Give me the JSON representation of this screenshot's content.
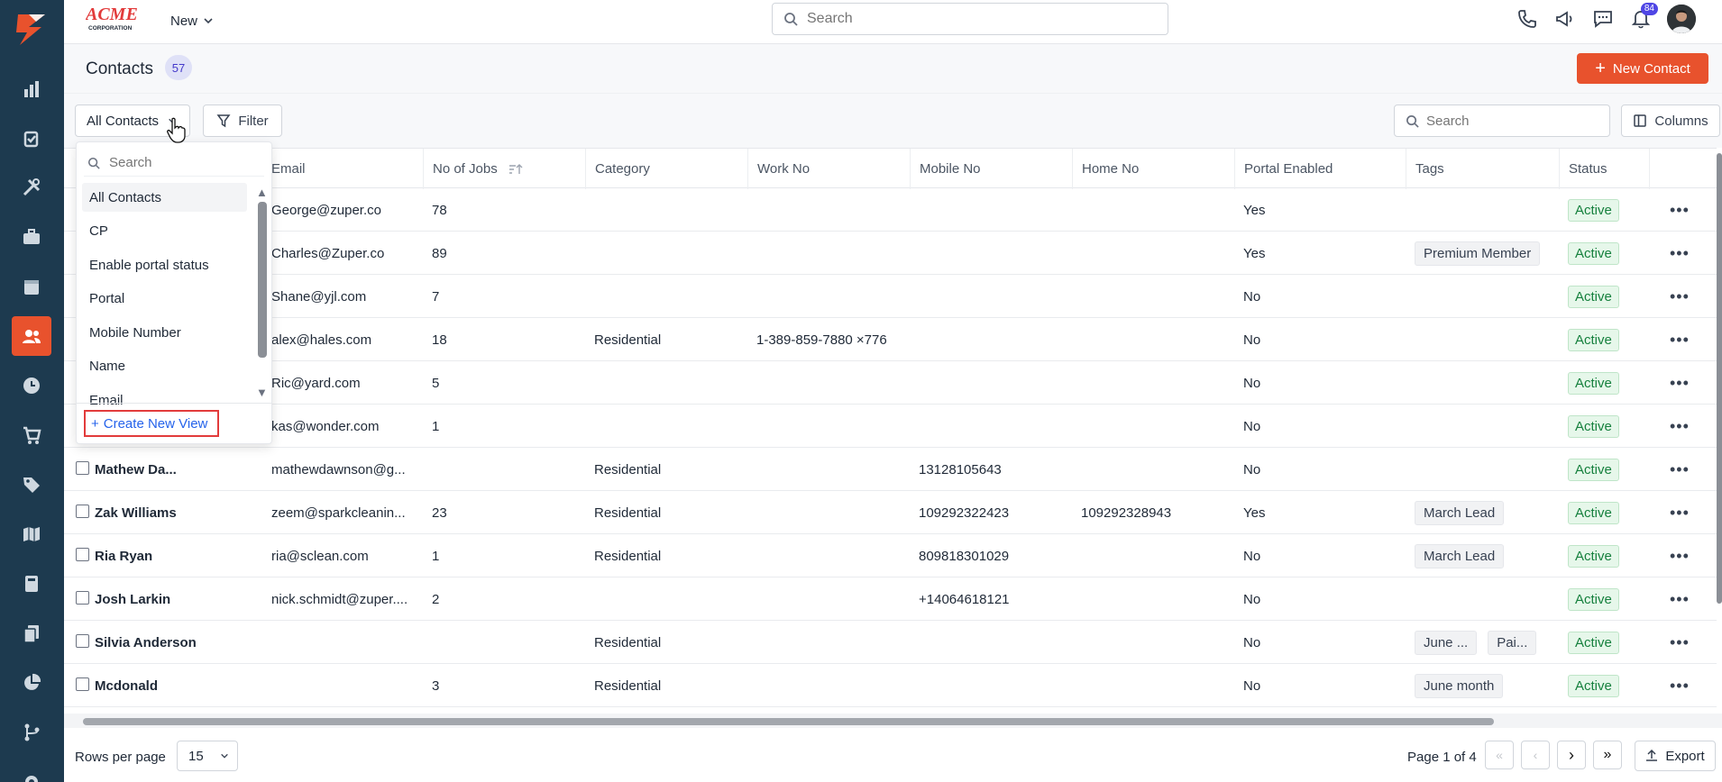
{
  "topbar": {
    "new_label": "New",
    "search_placeholder": "Search",
    "notification_count": "84"
  },
  "brand": {
    "name": "ACME",
    "sub": "CORPORATION"
  },
  "page": {
    "title": "Contacts",
    "count": "57",
    "new_button": "New Contact"
  },
  "toolbar": {
    "view_label": "All Contacts",
    "filter_label": "Filter",
    "search_placeholder": "Search",
    "columns_label": "Columns"
  },
  "columns": [
    "Email",
    "No of Jobs",
    "Category",
    "Work No",
    "Mobile No",
    "Home No",
    "Portal Enabled",
    "Tags",
    "Status"
  ],
  "rows": [
    {
      "name": "",
      "email": "George@zuper.co",
      "jobs": "78",
      "category": "",
      "work": "",
      "mobile": "",
      "home": "",
      "portal": "Yes",
      "tags": [],
      "status": "Active"
    },
    {
      "name": "",
      "email": "Charles@Zuper.co",
      "jobs": "89",
      "category": "",
      "work": "",
      "mobile": "",
      "home": "",
      "portal": "Yes",
      "tags": [
        "Premium Member"
      ],
      "status": "Active"
    },
    {
      "name": "",
      "email": "Shane@yjl.com",
      "jobs": "7",
      "category": "",
      "work": "",
      "mobile": "",
      "home": "",
      "portal": "No",
      "tags": [],
      "status": "Active"
    },
    {
      "name": "",
      "email": "alex@hales.com",
      "jobs": "18",
      "category": "Residential",
      "work": "1-389-859-7880 ×776",
      "mobile": "",
      "home": "",
      "portal": "No",
      "tags": [],
      "status": "Active"
    },
    {
      "name": "",
      "email": "Ric@yard.com",
      "jobs": "5",
      "category": "",
      "work": "",
      "mobile": "",
      "home": "",
      "portal": "No",
      "tags": [],
      "status": "Active"
    },
    {
      "name": "",
      "email": "kas@wonder.com",
      "jobs": "1",
      "category": "",
      "work": "",
      "mobile": "",
      "home": "",
      "portal": "No",
      "tags": [],
      "status": "Active"
    },
    {
      "name": "Mathew Da...",
      "email": "mathewdawnson@g...",
      "jobs": "",
      "category": "Residential",
      "work": "",
      "mobile": "13128105643",
      "home": "",
      "portal": "No",
      "tags": [],
      "status": "Active"
    },
    {
      "name": "Zak Williams",
      "email": "zeem@sparkcleanin...",
      "jobs": "23",
      "category": "Residential",
      "work": "",
      "mobile": "109292322423",
      "home": "109292328943",
      "portal": "Yes",
      "tags": [
        "March Lead"
      ],
      "status": "Active"
    },
    {
      "name": "Ria Ryan",
      "email": "ria@sclean.com",
      "jobs": "1",
      "category": "Residential",
      "work": "",
      "mobile": "809818301029",
      "home": "",
      "portal": "No",
      "tags": [
        "March Lead"
      ],
      "status": "Active"
    },
    {
      "name": "Josh Larkin",
      "email": "nick.schmidt@zuper....",
      "jobs": "2",
      "category": "",
      "work": "",
      "mobile": "+14064618121",
      "home": "",
      "portal": "No",
      "tags": [],
      "status": "Active"
    },
    {
      "name": "Silvia Anderson",
      "email": "",
      "jobs": "",
      "category": "Residential",
      "work": "",
      "mobile": "",
      "home": "",
      "portal": "No",
      "tags": [
        "June ...",
        "Pai..."
      ],
      "status": "Active"
    },
    {
      "name": "Mcdonald",
      "email": "",
      "jobs": "3",
      "category": "Residential",
      "work": "",
      "mobile": "",
      "home": "",
      "portal": "No",
      "tags": [
        "June month"
      ],
      "status": "Active"
    }
  ],
  "dropdown": {
    "search_placeholder": "Search",
    "items": [
      "All Contacts",
      "CP",
      "Enable portal status",
      "Portal",
      "Mobile Number",
      "Name",
      "Email"
    ],
    "selected": "All Contacts",
    "create_label": "Create New View"
  },
  "footer": {
    "rows_per_page_label": "Rows per page",
    "rows_per_page_value": "15",
    "page_info": "Page 1 of 4",
    "export_label": "Export"
  },
  "colors": {
    "rail": "#1d3a4f",
    "accent": "#e8522d",
    "active_status": "#15803d",
    "link": "#2563eb"
  },
  "rail_icons": [
    "dashboard-icon",
    "jobs-icon",
    "tools-icon",
    "briefcase-icon",
    "calendar-icon",
    "contacts-icon",
    "clock-icon",
    "cart-icon",
    "tag-icon",
    "map-icon",
    "calculator-icon",
    "documents-icon",
    "reports-icon",
    "workflow-icon",
    "settings-icon"
  ]
}
